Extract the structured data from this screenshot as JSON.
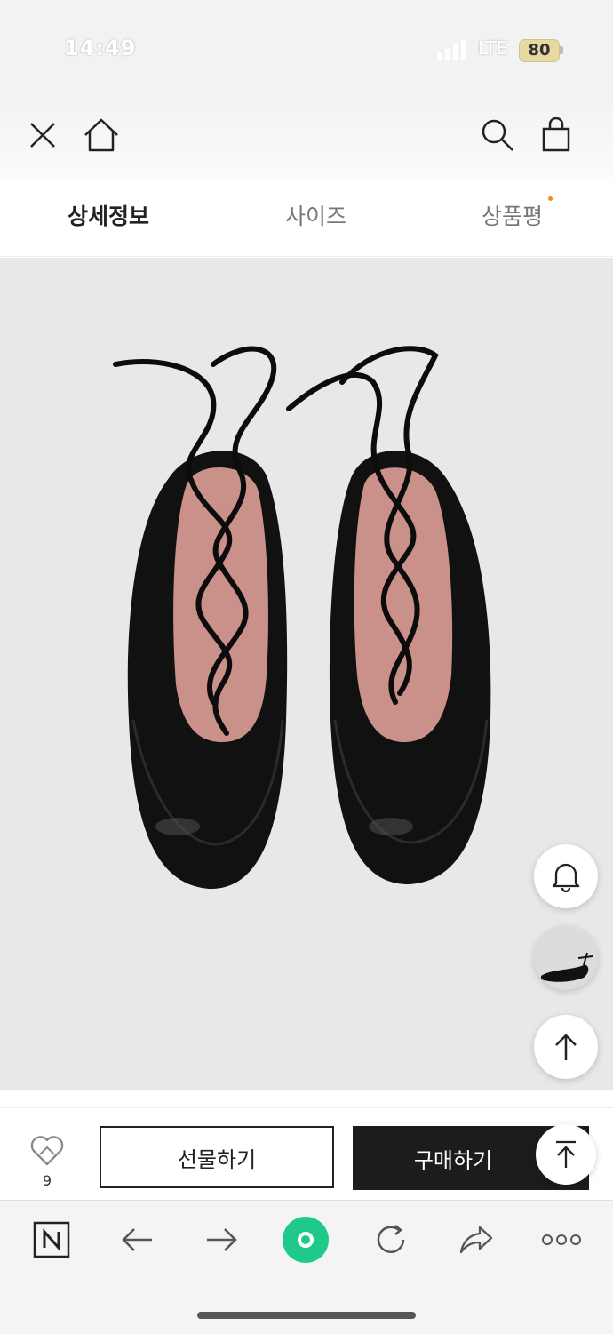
{
  "status_bar": {
    "time": "14:49",
    "network": "LTE",
    "battery": "80"
  },
  "tabs": [
    {
      "label": "상세정보",
      "active": true
    },
    {
      "label": "사이즈",
      "active": false
    },
    {
      "label": "상품평",
      "active": false
    }
  ],
  "action_bar": {
    "wish_count": "9",
    "gift_label": "선물하기",
    "buy_label": "구매하기"
  },
  "icons": {
    "top_nav": [
      "close-icon",
      "home-icon",
      "search-icon",
      "shopping-bag-icon"
    ],
    "floating": [
      "bell-icon",
      "thumbnail",
      "arrow-up-icon"
    ],
    "browser": [
      "naver-icon",
      "back-icon",
      "forward-icon",
      "green-dot-icon",
      "refresh-icon",
      "share-icon",
      "more-icon"
    ]
  },
  "colors": {
    "accent_dot": "#f08a24",
    "buy_button": "#1c1c1c",
    "browser_green": "#1ec98a"
  }
}
